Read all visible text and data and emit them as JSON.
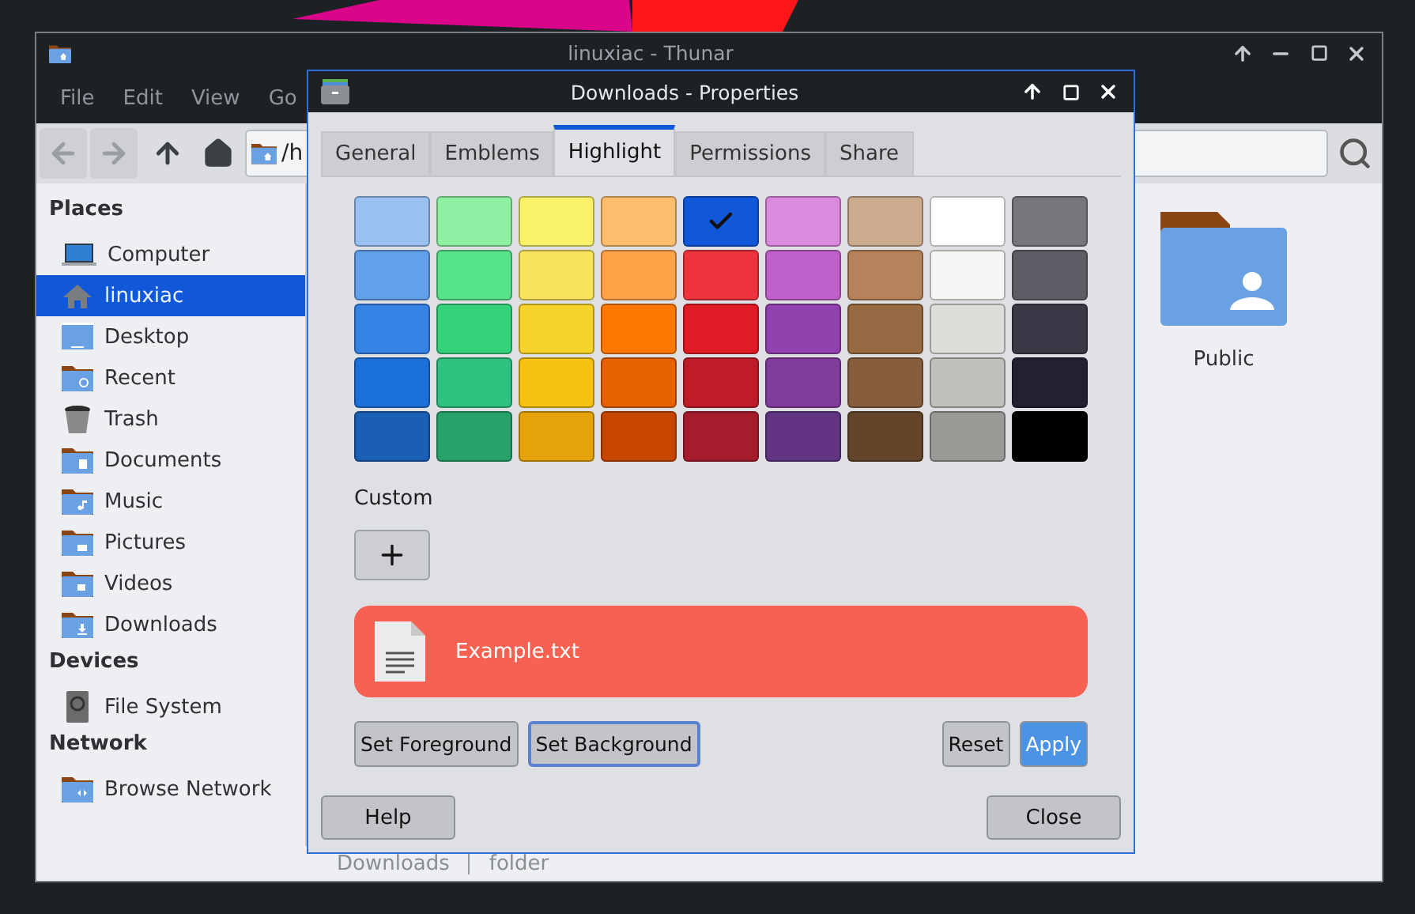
{
  "thunar": {
    "title": "linuxiac - Thunar",
    "menu": [
      "File",
      "Edit",
      "View",
      "Go"
    ],
    "location": "/h",
    "sidebar": [
      {
        "heading": "Places",
        "items": [
          {
            "label": "Computer",
            "kind": "computer",
            "selected": false
          },
          {
            "label": "linuxiac",
            "kind": "home",
            "selected": true
          },
          {
            "label": "Desktop",
            "kind": "desktop",
            "selected": false
          },
          {
            "label": "Recent",
            "kind": "recent",
            "selected": false
          },
          {
            "label": "Trash",
            "kind": "trash",
            "selected": false
          },
          {
            "label": "Documents",
            "kind": "documents",
            "selected": false
          },
          {
            "label": "Music",
            "kind": "music",
            "selected": false
          },
          {
            "label": "Pictures",
            "kind": "pictures",
            "selected": false
          },
          {
            "label": "Videos",
            "kind": "videos",
            "selected": false
          },
          {
            "label": "Downloads",
            "kind": "downloads",
            "selected": false
          }
        ]
      },
      {
        "heading": "Devices",
        "items": [
          {
            "label": "File System",
            "kind": "drive",
            "selected": false
          }
        ]
      },
      {
        "heading": "Network",
        "items": [
          {
            "label": "Browse Network",
            "kind": "network",
            "selected": false
          }
        ]
      }
    ],
    "files": [
      {
        "label": "Public"
      }
    ],
    "status": [
      "Downloads",
      "folder"
    ]
  },
  "dialog": {
    "title": "Downloads - Properties",
    "tabs": [
      {
        "label": "General",
        "selected": false
      },
      {
        "label": "Emblems",
        "selected": false
      },
      {
        "label": "Highlight",
        "selected": true
      },
      {
        "label": "Permissions",
        "selected": false
      },
      {
        "label": "Share",
        "selected": false
      }
    ],
    "palette": [
      {
        "swatches": [
          {
            "color": "#99c1f1",
            "selected": false
          },
          {
            "color": "#8ff0a4",
            "selected": false
          },
          {
            "color": "#f9f06b",
            "selected": false
          },
          {
            "color": "#ffbe6f",
            "selected": false
          },
          {
            "selected": true
          },
          {
            "color": "#dc8add",
            "selected": false
          },
          {
            "color": "#cdab8f",
            "selected": false
          },
          {
            "color": "#ffffff",
            "selected": false
          },
          {
            "color": "#77767b",
            "selected": false
          }
        ]
      },
      {
        "swatches": [
          {
            "color": "#62a0ea",
            "selected": false
          },
          {
            "color": "#57e389",
            "selected": false
          },
          {
            "color": "#f8e45c",
            "selected": false
          },
          {
            "color": "#ffa348",
            "selected": false
          },
          {
            "color": "#ed333b",
            "selected": false
          },
          {
            "color": "#c061cb",
            "selected": false
          },
          {
            "color": "#b5835a",
            "selected": false
          },
          {
            "color": "#f6f5f4",
            "selected": false
          },
          {
            "color": "#5e5c64",
            "selected": false
          }
        ]
      },
      {
        "swatches": [
          {
            "color": "#3584e4",
            "selected": false
          },
          {
            "color": "#33d17a",
            "selected": false
          },
          {
            "color": "#f6d32d",
            "selected": false
          },
          {
            "color": "#ff7800",
            "selected": false
          },
          {
            "color": "#e01b24",
            "selected": false
          },
          {
            "color": "#9141ac",
            "selected": false
          },
          {
            "color": "#986a44",
            "selected": false
          },
          {
            "color": "#deddda",
            "selected": false
          },
          {
            "color": "#3d3846",
            "selected": false
          }
        ]
      },
      {
        "swatches": [
          {
            "color": "#1c71d8",
            "selected": false
          },
          {
            "color": "#2ec27e",
            "selected": false
          },
          {
            "color": "#f5c211",
            "selected": false
          },
          {
            "color": "#e66100",
            "selected": false
          },
          {
            "color": "#c01c28",
            "selected": false
          },
          {
            "color": "#813d9c",
            "selected": false
          },
          {
            "color": "#865e3c",
            "selected": false
          },
          {
            "color": "#c0bfbc",
            "selected": false
          },
          {
            "color": "#241f31",
            "selected": false
          }
        ]
      },
      {
        "swatches": [
          {
            "color": "#1a5fb4",
            "selected": false
          },
          {
            "color": "#26a269",
            "selected": false
          },
          {
            "color": "#e5a50a",
            "selected": false
          },
          {
            "color": "#c64600",
            "selected": false
          },
          {
            "color": "#a51d2d",
            "selected": false
          },
          {
            "color": "#613583",
            "selected": false
          },
          {
            "color": "#63452c",
            "selected": false
          },
          {
            "color": "#9a9996",
            "selected": false
          },
          {
            "color": "#000000",
            "selected": false
          }
        ]
      }
    ],
    "custom_label": "Custom",
    "preview": {
      "filename": "Example.txt",
      "color": "#f66151"
    },
    "actions": [
      {
        "label": "Set Foreground",
        "kind": "normal",
        "focused": false
      },
      {
        "label": "Set Background",
        "kind": "normal",
        "focused": true
      },
      {
        "label": "Reset",
        "kind": "normal",
        "focused": false
      },
      {
        "label": "Apply",
        "kind": "primary",
        "focused": false
      }
    ],
    "footer": [
      "Help",
      "Close"
    ]
  }
}
